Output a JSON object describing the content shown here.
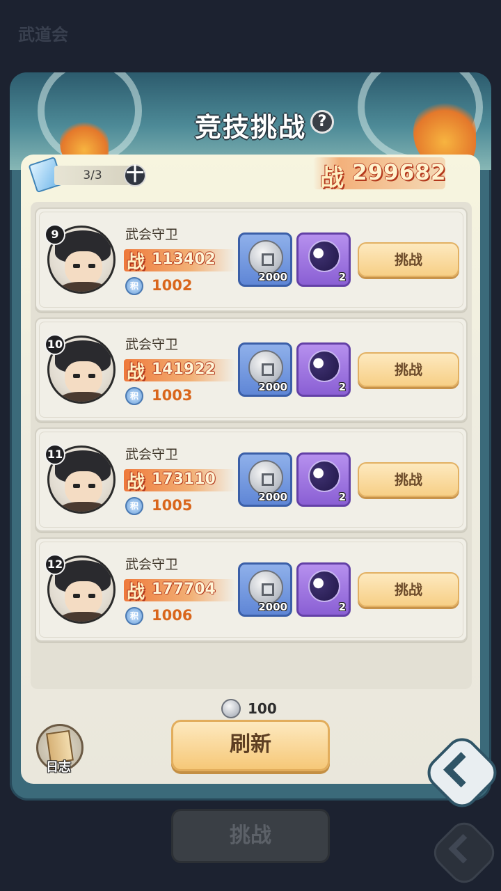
{
  "background": {
    "title": "武道会"
  },
  "panel": {
    "title": "竞技挑战",
    "help_symbol": "?",
    "tickets": {
      "value": "3/3",
      "plus_symbol": "十"
    },
    "total_power": {
      "glyph": "战",
      "value": "299682"
    }
  },
  "opponents": [
    {
      "rank": "9",
      "name": "武会守卫",
      "power": "113402",
      "score_glyph": "积",
      "score": "1002",
      "coin_qty": "2000",
      "orb_qty": "2",
      "button": "挑战"
    },
    {
      "rank": "10",
      "name": "武会守卫",
      "power": "141922",
      "score_glyph": "积",
      "score": "1003",
      "coin_qty": "2000",
      "orb_qty": "2",
      "button": "挑战"
    },
    {
      "rank": "11",
      "name": "武会守卫",
      "power": "173110",
      "score_glyph": "积",
      "score": "1005",
      "coin_qty": "2000",
      "orb_qty": "2",
      "button": "挑战"
    },
    {
      "rank": "12",
      "name": "武会守卫",
      "power": "177704",
      "score_glyph": "积",
      "score": "1006",
      "coin_qty": "2000",
      "orb_qty": "2",
      "button": "挑战"
    }
  ],
  "power_glyph": "战",
  "bottom": {
    "refresh_cost": "100",
    "refresh_label": "刷新",
    "log_label": "日志",
    "background_challenge_label": "挑战"
  },
  "colors": {
    "panel_teal": "#3b6a7a",
    "panel_cream": "#f1efe7",
    "button_gold": "#f7cf86",
    "score_orange": "#d9661c",
    "coin_tile": "#5f86d6",
    "orb_tile": "#8a5fd4"
  },
  "icons": [
    "ticket-icon",
    "plus-icon",
    "help-icon",
    "coin-icon",
    "spirit-orb-icon",
    "score-icon",
    "log-book-icon",
    "back-arrow-icon"
  ]
}
